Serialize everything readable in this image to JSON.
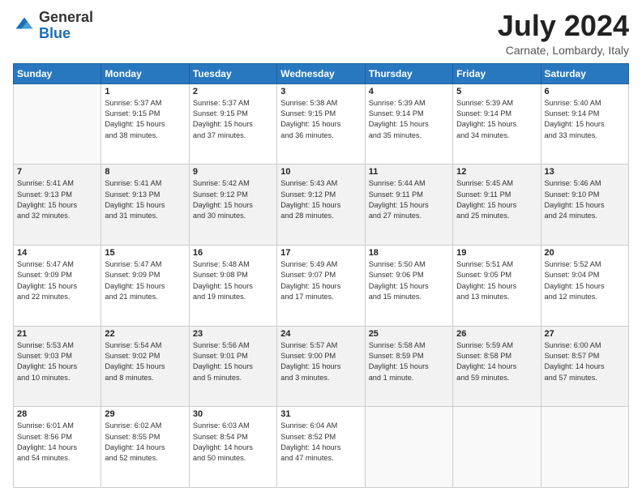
{
  "header": {
    "logo": {
      "general": "General",
      "blue": "Blue"
    },
    "title": "July 2024",
    "location": "Carnate, Lombardy, Italy"
  },
  "weekdays": [
    "Sunday",
    "Monday",
    "Tuesday",
    "Wednesday",
    "Thursday",
    "Friday",
    "Saturday"
  ],
  "weeks": [
    [
      {
        "day": "",
        "info": ""
      },
      {
        "day": "1",
        "info": "Sunrise: 5:37 AM\nSunset: 9:15 PM\nDaylight: 15 hours\nand 38 minutes."
      },
      {
        "day": "2",
        "info": "Sunrise: 5:37 AM\nSunset: 9:15 PM\nDaylight: 15 hours\nand 37 minutes."
      },
      {
        "day": "3",
        "info": "Sunrise: 5:38 AM\nSunset: 9:15 PM\nDaylight: 15 hours\nand 36 minutes."
      },
      {
        "day": "4",
        "info": "Sunrise: 5:39 AM\nSunset: 9:14 PM\nDaylight: 15 hours\nand 35 minutes."
      },
      {
        "day": "5",
        "info": "Sunrise: 5:39 AM\nSunset: 9:14 PM\nDaylight: 15 hours\nand 34 minutes."
      },
      {
        "day": "6",
        "info": "Sunrise: 5:40 AM\nSunset: 9:14 PM\nDaylight: 15 hours\nand 33 minutes."
      }
    ],
    [
      {
        "day": "7",
        "info": "Sunrise: 5:41 AM\nSunset: 9:13 PM\nDaylight: 15 hours\nand 32 minutes."
      },
      {
        "day": "8",
        "info": "Sunrise: 5:41 AM\nSunset: 9:13 PM\nDaylight: 15 hours\nand 31 minutes."
      },
      {
        "day": "9",
        "info": "Sunrise: 5:42 AM\nSunset: 9:12 PM\nDaylight: 15 hours\nand 30 minutes."
      },
      {
        "day": "10",
        "info": "Sunrise: 5:43 AM\nSunset: 9:12 PM\nDaylight: 15 hours\nand 28 minutes."
      },
      {
        "day": "11",
        "info": "Sunrise: 5:44 AM\nSunset: 9:11 PM\nDaylight: 15 hours\nand 27 minutes."
      },
      {
        "day": "12",
        "info": "Sunrise: 5:45 AM\nSunset: 9:11 PM\nDaylight: 15 hours\nand 25 minutes."
      },
      {
        "day": "13",
        "info": "Sunrise: 5:46 AM\nSunset: 9:10 PM\nDaylight: 15 hours\nand 24 minutes."
      }
    ],
    [
      {
        "day": "14",
        "info": "Sunrise: 5:47 AM\nSunset: 9:09 PM\nDaylight: 15 hours\nand 22 minutes."
      },
      {
        "day": "15",
        "info": "Sunrise: 5:47 AM\nSunset: 9:09 PM\nDaylight: 15 hours\nand 21 minutes."
      },
      {
        "day": "16",
        "info": "Sunrise: 5:48 AM\nSunset: 9:08 PM\nDaylight: 15 hours\nand 19 minutes."
      },
      {
        "day": "17",
        "info": "Sunrise: 5:49 AM\nSunset: 9:07 PM\nDaylight: 15 hours\nand 17 minutes."
      },
      {
        "day": "18",
        "info": "Sunrise: 5:50 AM\nSunset: 9:06 PM\nDaylight: 15 hours\nand 15 minutes."
      },
      {
        "day": "19",
        "info": "Sunrise: 5:51 AM\nSunset: 9:05 PM\nDaylight: 15 hours\nand 13 minutes."
      },
      {
        "day": "20",
        "info": "Sunrise: 5:52 AM\nSunset: 9:04 PM\nDaylight: 15 hours\nand 12 minutes."
      }
    ],
    [
      {
        "day": "21",
        "info": "Sunrise: 5:53 AM\nSunset: 9:03 PM\nDaylight: 15 hours\nand 10 minutes."
      },
      {
        "day": "22",
        "info": "Sunrise: 5:54 AM\nSunset: 9:02 PM\nDaylight: 15 hours\nand 8 minutes."
      },
      {
        "day": "23",
        "info": "Sunrise: 5:56 AM\nSunset: 9:01 PM\nDaylight: 15 hours\nand 5 minutes."
      },
      {
        "day": "24",
        "info": "Sunrise: 5:57 AM\nSunset: 9:00 PM\nDaylight: 15 hours\nand 3 minutes."
      },
      {
        "day": "25",
        "info": "Sunrise: 5:58 AM\nSunset: 8:59 PM\nDaylight: 15 hours\nand 1 minute."
      },
      {
        "day": "26",
        "info": "Sunrise: 5:59 AM\nSunset: 8:58 PM\nDaylight: 14 hours\nand 59 minutes."
      },
      {
        "day": "27",
        "info": "Sunrise: 6:00 AM\nSunset: 8:57 PM\nDaylight: 14 hours\nand 57 minutes."
      }
    ],
    [
      {
        "day": "28",
        "info": "Sunrise: 6:01 AM\nSunset: 8:56 PM\nDaylight: 14 hours\nand 54 minutes."
      },
      {
        "day": "29",
        "info": "Sunrise: 6:02 AM\nSunset: 8:55 PM\nDaylight: 14 hours\nand 52 minutes."
      },
      {
        "day": "30",
        "info": "Sunrise: 6:03 AM\nSunset: 8:54 PM\nDaylight: 14 hours\nand 50 minutes."
      },
      {
        "day": "31",
        "info": "Sunrise: 6:04 AM\nSunset: 8:52 PM\nDaylight: 14 hours\nand 47 minutes."
      },
      {
        "day": "",
        "info": ""
      },
      {
        "day": "",
        "info": ""
      },
      {
        "day": "",
        "info": ""
      }
    ]
  ]
}
